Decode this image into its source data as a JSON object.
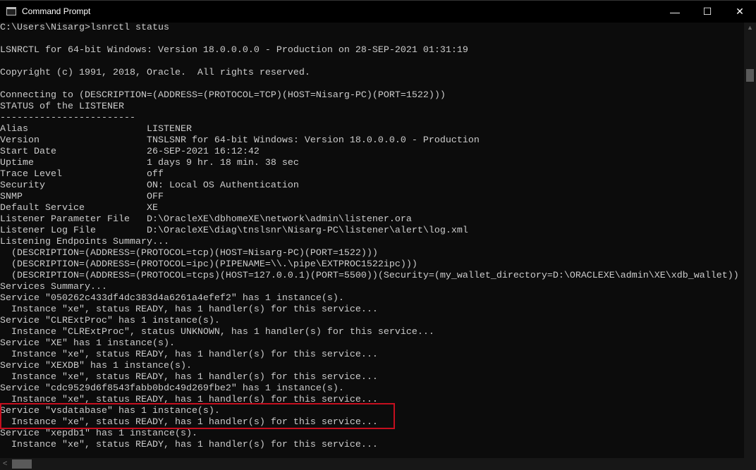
{
  "window": {
    "title": "Command Prompt",
    "minimize": "—",
    "maximize": "☐",
    "close": "✕"
  },
  "terminal": {
    "lines": [
      "C:\\Users\\Nisarg>lsnrctl status",
      "",
      "LSNRCTL for 64-bit Windows: Version 18.0.0.0.0 - Production on 28-SEP-2021 01:31:19",
      "",
      "Copyright (c) 1991, 2018, Oracle.  All rights reserved.",
      "",
      "Connecting to (DESCRIPTION=(ADDRESS=(PROTOCOL=TCP)(HOST=Nisarg-PC)(PORT=1522)))",
      "STATUS of the LISTENER",
      "------------------------",
      "Alias                     LISTENER",
      "Version                   TNSLSNR for 64-bit Windows: Version 18.0.0.0.0 - Production",
      "Start Date                26-SEP-2021 16:12:42",
      "Uptime                    1 days 9 hr. 18 min. 38 sec",
      "Trace Level               off",
      "Security                  ON: Local OS Authentication",
      "SNMP                      OFF",
      "Default Service           XE",
      "Listener Parameter File   D:\\OracleXE\\dbhomeXE\\network\\admin\\listener.ora",
      "Listener Log File         D:\\OracleXE\\diag\\tnslsnr\\Nisarg-PC\\listener\\alert\\log.xml",
      "Listening Endpoints Summary...",
      "  (DESCRIPTION=(ADDRESS=(PROTOCOL=tcp)(HOST=Nisarg-PC)(PORT=1522)))",
      "  (DESCRIPTION=(ADDRESS=(PROTOCOL=ipc)(PIPENAME=\\\\.\\pipe\\EXTPROC1522ipc)))",
      "  (DESCRIPTION=(ADDRESS=(PROTOCOL=tcps)(HOST=127.0.0.1)(PORT=5500))(Security=(my_wallet_directory=D:\\ORACLEXE\\admin\\XE\\xdb_wallet))",
      "Services Summary...",
      "Service \"050262c433df4dc383d4a6261a4efef2\" has 1 instance(s).",
      "  Instance \"xe\", status READY, has 1 handler(s) for this service...",
      "Service \"CLRExtProc\" has 1 instance(s).",
      "  Instance \"CLRExtProc\", status UNKNOWN, has 1 handler(s) for this service...",
      "Service \"XE\" has 1 instance(s).",
      "  Instance \"xe\", status READY, has 1 handler(s) for this service...",
      "Service \"XEXDB\" has 1 instance(s).",
      "  Instance \"xe\", status READY, has 1 handler(s) for this service...",
      "Service \"cdc9529d6f8543fabb0bdc49d269fbe2\" has 1 instance(s).",
      "  Instance \"xe\", status READY, has 1 handler(s) for this service...",
      "Service \"vsdatabase\" has 1 instance(s).",
      "  Instance \"xe\", status READY, has 1 handler(s) for this service...",
      "Service \"xepdb1\" has 1 instance(s).",
      "  Instance \"xe\", status READY, has 1 handler(s) for this service..."
    ]
  },
  "colors": {
    "background": "#0c0c0c",
    "text": "#cccccc",
    "highlight_box": "#c50f1f"
  }
}
